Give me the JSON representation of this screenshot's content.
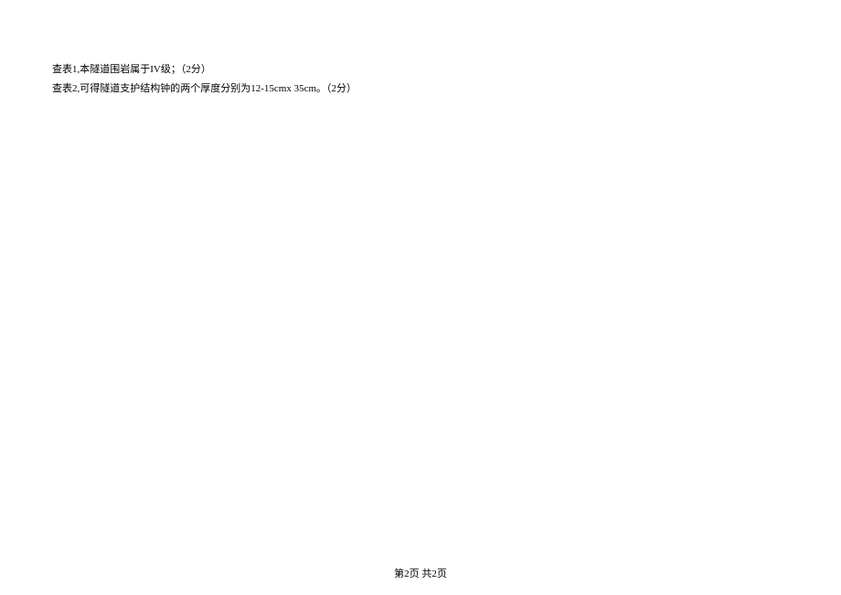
{
  "content": {
    "line1": "查表1,本隧道围岩属于IV级；（2分）",
    "line2": "查表2,可得隧道支护结构钟的两个厚度分别为12-15cmx 35cm。（2分）"
  },
  "footer": {
    "pagination": "第2页 共2页"
  }
}
